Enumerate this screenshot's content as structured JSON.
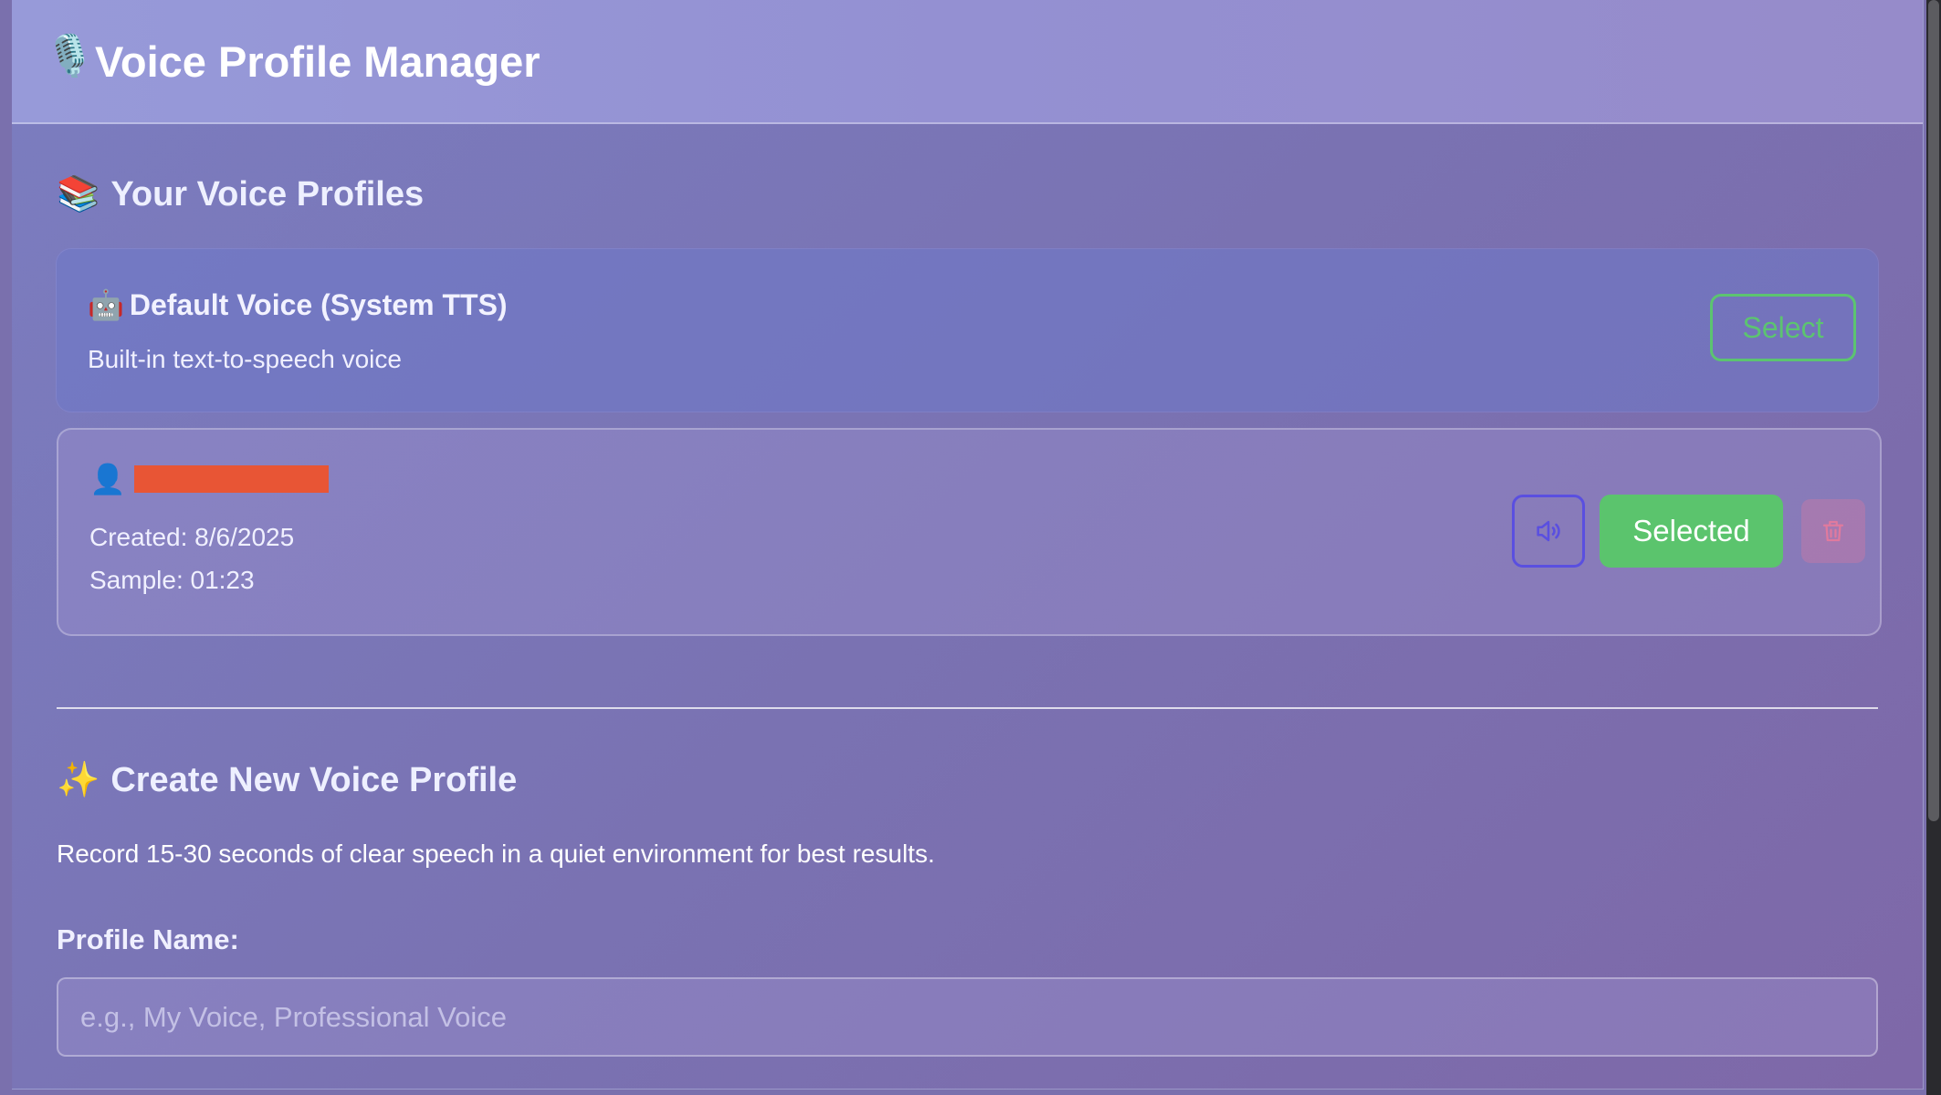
{
  "app": {
    "title": "Voice Profile Manager",
    "title_icon": "🎙️",
    "title_icon_name": "microphone-icon"
  },
  "profiles_section": {
    "icon": "📚",
    "title": "Your Voice Profiles"
  },
  "profiles": [
    {
      "icon": "🤖",
      "icon_name": "robot-icon",
      "name": "Default Voice (System TTS)",
      "description": "Built-in text-to-speech voice",
      "button_label": "Select"
    },
    {
      "icon": "👤",
      "icon_name": "person-icon",
      "name_redacted": true,
      "created": "Created: 8/6/2025",
      "sample": "Sample: 01:23",
      "play_icon": "speaker-icon",
      "button_label": "Selected",
      "delete_icon": "trash-icon"
    }
  ],
  "create_section": {
    "icon": "✨",
    "title": "Create New Voice Profile",
    "description": "Record 15-30 seconds of clear speech in a quiet environment for best results.",
    "field_label": "Profile Name:",
    "field_placeholder": "e.g., My Voice, Professional Voice",
    "field_value": ""
  },
  "colors": {
    "accent_green": "#5bc46d",
    "accent_blue": "#5a4fe0",
    "redaction": "#e85535"
  }
}
